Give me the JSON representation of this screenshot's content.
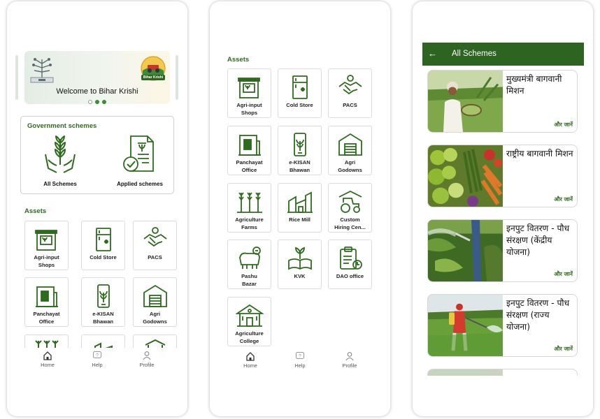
{
  "screen1": {
    "banner": {
      "title": "Welcome to Bihar Krishi",
      "logo_text": "Bihar Krishi"
    },
    "gov_section_title": "Government schemes",
    "gov_items": [
      {
        "label": "All Schemes"
      },
      {
        "label": "Applied schemes"
      }
    ],
    "assets_title": "Assets",
    "tiles": [
      {
        "label": "Agri-input\nShops",
        "icon": "shop-icon"
      },
      {
        "label": "Cold Store",
        "icon": "fridge-icon"
      },
      {
        "label": "PACS",
        "icon": "handshake-icon"
      },
      {
        "label": "Panchayat\nOffice",
        "icon": "building-icon"
      },
      {
        "label": "e-KISAN\nBhawan",
        "icon": "mobile-plant-icon"
      },
      {
        "label": "Agri\nGodowns",
        "icon": "warehouse-icon"
      }
    ]
  },
  "screen2": {
    "assets_title": "Assets",
    "tiles": [
      {
        "label": "Agri-input\nShops",
        "icon": "shop-icon"
      },
      {
        "label": "Cold Store",
        "icon": "fridge-icon"
      },
      {
        "label": "PACS",
        "icon": "handshake-icon"
      },
      {
        "label": "Panchayat\nOffice",
        "icon": "building-icon"
      },
      {
        "label": "e-KISAN\nBhawan",
        "icon": "mobile-plant-icon"
      },
      {
        "label": "Agri\nGodowns",
        "icon": "warehouse-icon"
      },
      {
        "label": "Agriculture\nFarms",
        "icon": "wheat-icon"
      },
      {
        "label": "Rice Mill",
        "icon": "mill-icon"
      },
      {
        "label": "Custom\nHiring Cen...",
        "icon": "tractor-icon"
      },
      {
        "label": "Pashu\nBazar",
        "icon": "cattle-icon"
      },
      {
        "label": "KVK",
        "icon": "book-plant-icon"
      },
      {
        "label": "DAO office",
        "icon": "clipboard-icon"
      },
      {
        "label": "Agriculture\nCollege",
        "icon": "college-icon"
      }
    ]
  },
  "screen3": {
    "title": "All Schemes",
    "back_icon": "←",
    "more_label": "और जानें",
    "cards": [
      {
        "title": "मुख्यमंत्री बागवानी मिशन"
      },
      {
        "title": "राष्ट्रीय बागवानी मिशन"
      },
      {
        "title": "इनपुट वितरण - पौध संरक्षण (केंद्रीय योजना)"
      },
      {
        "title": "इनपुट वितरण - पौध संरक्षण (राज्य योजना)"
      }
    ]
  },
  "nav": {
    "home": "Home",
    "help": "Help",
    "profile": "Profile"
  },
  "colors": {
    "primary": "#2d6422",
    "accent": "#4f8f3a",
    "dot_active": "#3f8a3a",
    "dot_inactive": "#ffffff"
  }
}
